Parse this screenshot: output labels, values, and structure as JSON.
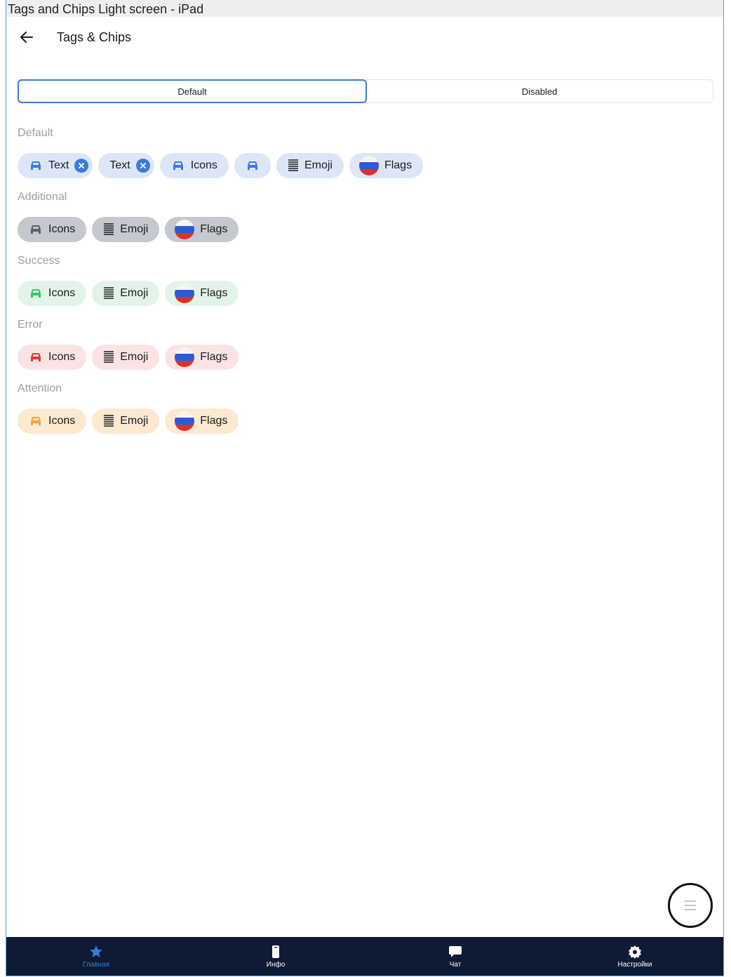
{
  "window": {
    "title": "Tags and Chips Light screen - iPad"
  },
  "header": {
    "title": "Tags & Chips"
  },
  "segmented": {
    "default_label": "Default",
    "disabled_label": "Disabled",
    "selected": "Default"
  },
  "sections": {
    "default": {
      "title": "Default",
      "chips": {
        "text1": "Text",
        "text2": "Text",
        "icons": "Icons",
        "emoji": "Emoji",
        "flags": "Flags"
      }
    },
    "additional": {
      "title": "Additional",
      "chips": {
        "icons": "Icons",
        "emoji": "Emoji",
        "flags": "Flags"
      }
    },
    "success": {
      "title": "Success",
      "chips": {
        "icons": "Icons",
        "emoji": "Emoji",
        "flags": "Flags"
      }
    },
    "error": {
      "title": "Error",
      "chips": {
        "icons": "Icons",
        "emoji": "Emoji",
        "flags": "Flags"
      }
    },
    "attention": {
      "title": "Attention",
      "chips": {
        "icons": "Icons",
        "emoji": "Emoji",
        "flags": "Flags"
      }
    }
  },
  "icons": {
    "back": "arrow-left-icon",
    "chip_icon": "car-icon",
    "chip_close": "close-circle-icon",
    "emoji": "list-lines-icon",
    "flag": "russia-flag-icon",
    "fab": "menu-icon"
  },
  "colors": {
    "accent": "#3a7bdc",
    "default_chip": "#dce6f6",
    "additional_chip": "#c5c8ce",
    "success_chip": "#e2f4e7",
    "error_chip": "#fbe3e3",
    "attention_chip": "#fde9cf",
    "icon_default": "#3a7bdc",
    "icon_additional": "#5b5f66",
    "icon_success": "#3cc26a",
    "icon_error": "#e53935",
    "icon_attention": "#f5a142",
    "tabbar_bg": "#0f1a35"
  },
  "tabbar": {
    "items": [
      {
        "label": "Главная",
        "icon": "star-icon",
        "active": true
      },
      {
        "label": "Инфо",
        "icon": "phone-icon",
        "active": false
      },
      {
        "label": "Чат",
        "icon": "chat-bubble-icon",
        "active": false
      },
      {
        "label": "Настройки",
        "icon": "gear-icon",
        "active": false
      }
    ]
  }
}
